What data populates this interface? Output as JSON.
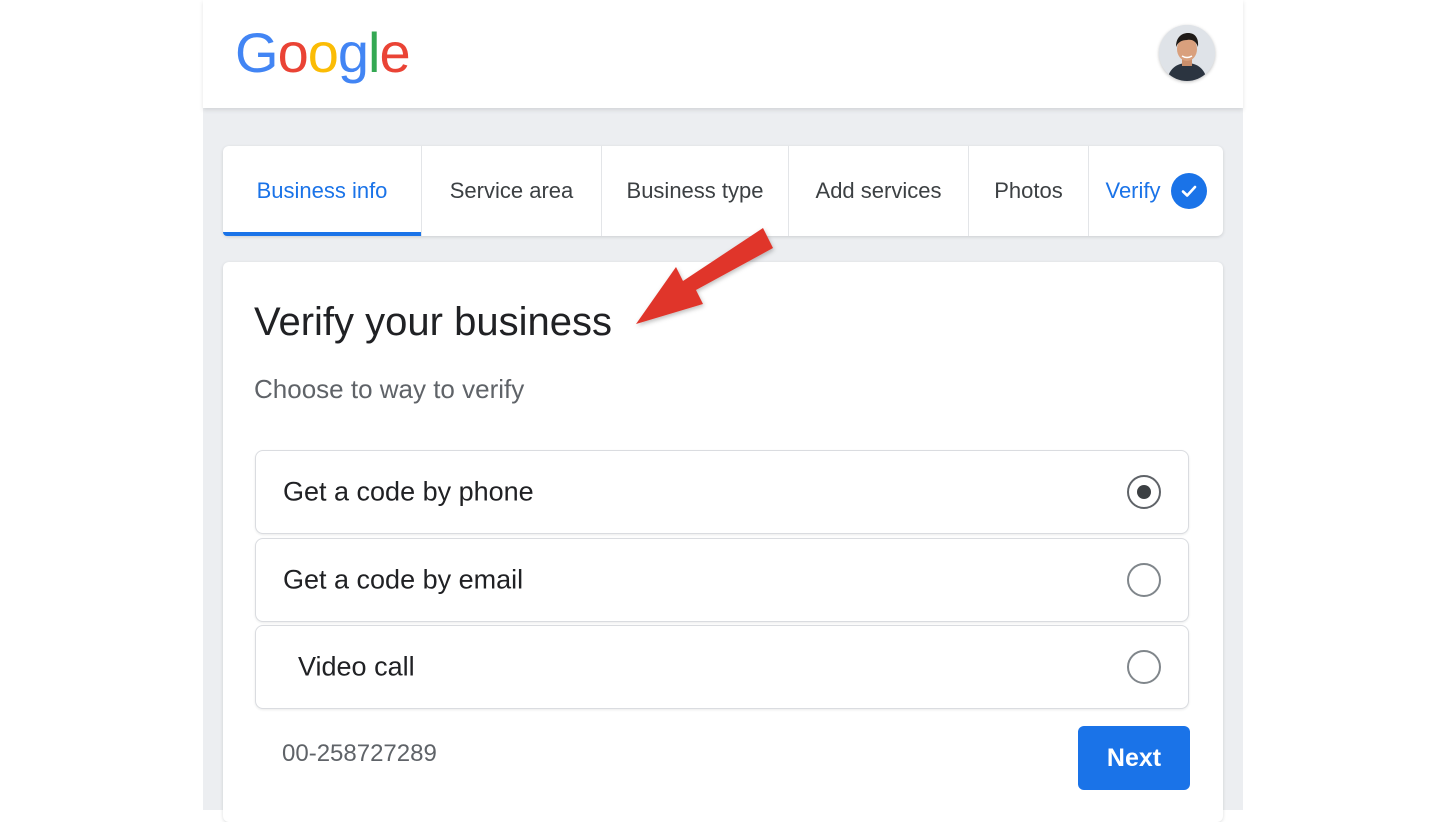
{
  "header": {
    "logo_letters": [
      {
        "ch": "G",
        "color": "#4285F4"
      },
      {
        "ch": "o",
        "color": "#EA4335"
      },
      {
        "ch": "o",
        "color": "#FBBC05"
      },
      {
        "ch": "g",
        "color": "#4285F4"
      },
      {
        "ch": "l",
        "color": "#34A853"
      },
      {
        "ch": "e",
        "color": "#EA4335"
      }
    ]
  },
  "tabs": [
    {
      "label": "Business info",
      "state": "active"
    },
    {
      "label": "Service area",
      "state": "default"
    },
    {
      "label": "Business type",
      "state": "default"
    },
    {
      "label": "Add services",
      "state": "default"
    },
    {
      "label": "Photos",
      "state": "default"
    },
    {
      "label": "Verify",
      "state": "completed"
    }
  ],
  "card": {
    "title": "Verify your business",
    "subtitle": "Choose to way to verify",
    "options": [
      {
        "label": "Get a code by phone",
        "selected": true
      },
      {
        "label": "Get a code by email",
        "selected": false
      },
      {
        "label": "Video call",
        "selected": false
      }
    ],
    "footer_number": "00-258727289",
    "next_label": "Next"
  },
  "colors": {
    "accent": "#1a73e8",
    "annotation_arrow": "#e0362c"
  },
  "icons": [
    "profile-avatar",
    "checkmark-icon",
    "radio-button",
    "annotation-arrow"
  ]
}
